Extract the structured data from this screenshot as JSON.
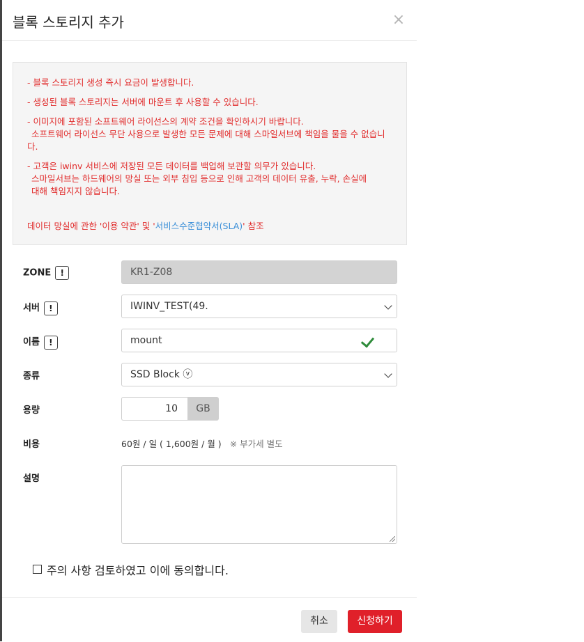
{
  "modal": {
    "title": "블록 스토리지 추가",
    "close_icon": "×"
  },
  "notice": {
    "line1": "- 블록 스토리지 생성 즉시 요금이 발생합니다.",
    "line2": "- 생성된 블록 스토리지는 서버에 마운트 후 사용할 수 있습니다.",
    "line3a": "- 이미지에 포함된 소프트웨어 라이선스의 계약 조건을 확인하시기 바랍니다.",
    "line3b": "소프트웨어 라이선스 무단 사용으로 발생한 모든 문제에 대해 스마일서브에 책임을 물을 수 없습니다.",
    "line4a": "- 고객은 iwinv 서비스에 저장된 모든 데이터를 백업해 보관할 의무가 있습니다.",
    "line4b": "스마일서브는 하드웨어의 망실 또는 외부 침입 등으로 인해 고객의 데이터 유출, 누락, 손실에",
    "line4c": "대해 책임지지 않습니다.",
    "ref_prefix": "데이터 망실에 관한 '이용 약관' 및 '",
    "ref_link": "서비스수준협약서(SLA)",
    "ref_suffix": "' 참조"
  },
  "form": {
    "help_icon": "!",
    "zone": {
      "label": "ZONE",
      "value": "KR1-Z08"
    },
    "server": {
      "label": "서버",
      "value": "IWINV_TEST(49."
    },
    "name": {
      "label": "이름",
      "value": "mount"
    },
    "type": {
      "label": "종류",
      "value": "SSD Block ⓥ"
    },
    "capacity": {
      "label": "용량",
      "value": "10",
      "unit": "GB"
    },
    "cost": {
      "label": "비용",
      "value": "60원 / 일 ( 1,600원 / 월 )",
      "vat": "※ 부가세 별도"
    },
    "description": {
      "label": "설명",
      "value": ""
    }
  },
  "agree": {
    "label": "주의 사항 검토하였고 이에 동의합니다."
  },
  "footer": {
    "cancel_label": "취소",
    "submit_label": "신청하기"
  },
  "colors": {
    "accent": "#e0202a",
    "notice_text": "#e12d2d",
    "link": "#3a8fd8",
    "valid": "#2e8b3a"
  }
}
